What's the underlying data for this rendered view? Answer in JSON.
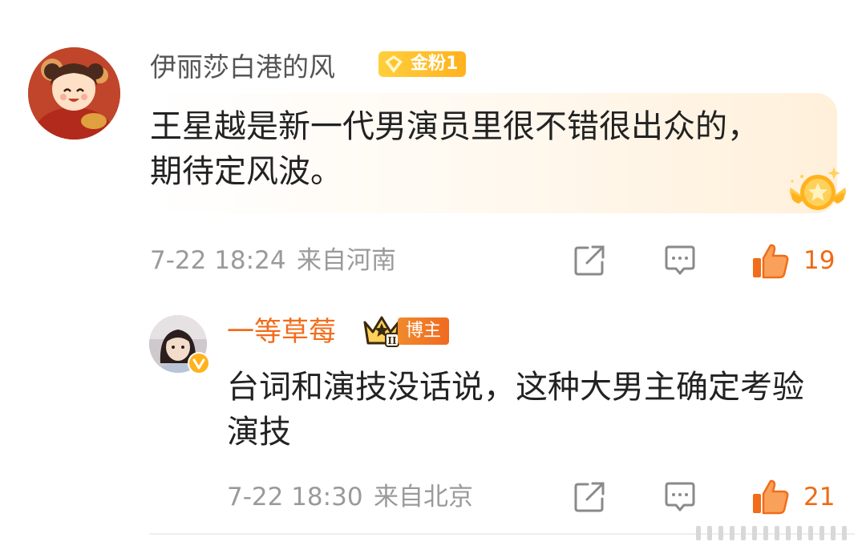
{
  "main_comment": {
    "username": "伊丽莎白港的风",
    "fan_badge": "金粉1",
    "text": "王星越是新一代男演员里很不错很出众的，期待定风波。",
    "time": "7-22 18:24",
    "location": "来自河南",
    "like_count": "19",
    "avatar_icon": "cartoon-girl-avatar",
    "medal_icon": "gold-star-medal-icon"
  },
  "reply": {
    "username": "一等草莓",
    "level_badge": "II",
    "role_badge": "博主",
    "text": "台词和演技没话说，这种大男主确定考验演技",
    "time": "7-22 18:30",
    "location": "来自北京",
    "like_count": "21",
    "avatar_icon": "girl-photo-avatar",
    "verified_icon": "verified-v-icon"
  },
  "actions": {
    "share_icon": "share-box-icon",
    "comment_icon": "comment-bubble-icon",
    "like_icon": "thumbs-up-icon"
  },
  "colors": {
    "accent_orange": "#f26c1a",
    "gold": "#ffb21e",
    "meta_gray": "#9a9a9a",
    "text_dark": "#222222"
  }
}
